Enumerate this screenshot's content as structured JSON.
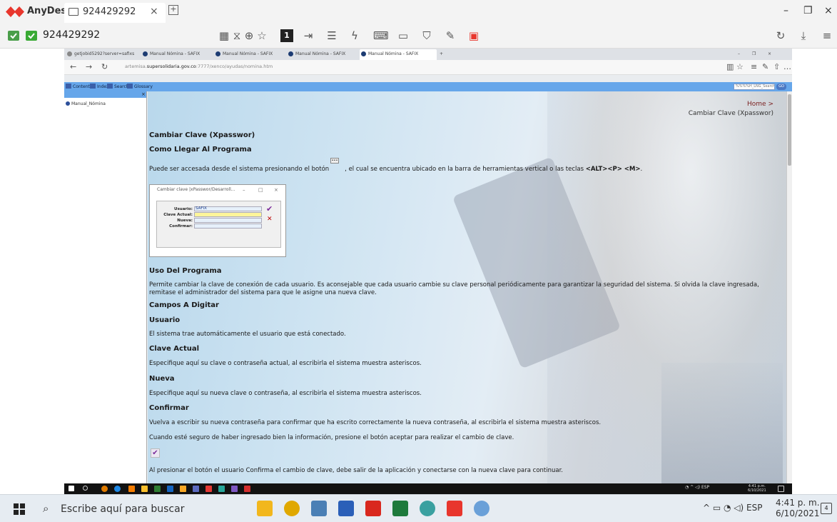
{
  "anydesk": {
    "app_name": "AnyDesk",
    "tab_label": "924429292",
    "tab_close": "×",
    "address": "924429292",
    "colors": {
      "brand_red": "#e8362d",
      "titlebar": "#f3f3f3"
    },
    "toolbar_icons": [
      "privacy-icon",
      "lock-icon",
      "star-icon",
      "monitor-1-icon",
      "switch-side-icon",
      "chat-icon",
      "actions-icon",
      "keyboard-icon",
      "display-icon",
      "shield-icon",
      "draw-icon",
      "screenshot-icon"
    ],
    "monitor_number": "1",
    "window_controls": {
      "minimize": "–",
      "restore": "❐",
      "close": "×"
    }
  },
  "edge": {
    "tabs": [
      {
        "label": "getjobid5292?server=safixs"
      },
      {
        "label": "Manual Nómina - SAFIX"
      },
      {
        "label": "Manual Nómina - SAFIX"
      },
      {
        "label": "Manual Nómina - SAFIX"
      },
      {
        "label": "Manual Nómina - SAFIX"
      }
    ],
    "url_prefix": "artemisa.",
    "url_domain": "supersolidaria.gov.co",
    "url_suffix": ":7777/xenco/ayudas/nomina.htm"
  },
  "help_toolbar": {
    "contents": "Contents",
    "index": "Index",
    "search": "Search",
    "glossary": "Glossary",
    "search_placeholder": "%%%%H_LNG_Search%%",
    "go": "GO"
  },
  "toc": {
    "root": "Manual_Nómina",
    "close": "×"
  },
  "breadcrumb": {
    "home": "Home >",
    "current": "Cambiar Clave (Xpasswor)"
  },
  "doc": {
    "title": "Cambiar Clave (Xpasswor)",
    "h_llegar": "Como Llegar Al Programa",
    "p_llegar_a": "Puede ser accesada desde el sistema presionando el botón",
    "p_llegar_b": ", el cual se encuentra ubicado en la barra de herramientas vertical o las teclas",
    "p_llegar_keys": "<ALT><P> <M>",
    "p_llegar_end": ".",
    "dialog": {
      "title": "Cambiar clave |xPasswor/Desarroll...",
      "usuario_label": "Usuario:",
      "usuario_value": "SAFIX",
      "actual_label": "Clave Actual:",
      "nueva_label": "Nueva:",
      "confirmar_label": "Confirmar:"
    },
    "h_uso": "Uso Del Programa",
    "p_uso_1": "Permite cambiar la clave de conexión de cada usuario. Es aconsejable que cada usuario cambie su clave personal periódicamente para garantizar la seguridad del sistema. Si olvida la clave ingresada,",
    "p_uso_2": "remitase el administrador del sistema para que le asigne una nueva clave.",
    "h_campos": "Campos A Digitar",
    "h_usuario": "Usuario",
    "p_usuario": "El sistema trae automáticamente el usuario que está conectado.",
    "h_actual": "Clave Actual",
    "p_actual": "Especifique aquí su clave o contraseña actual, al escribirla el sistema muestra asteriscos.",
    "h_nueva": "Nueva",
    "p_nueva": "Especifique aquí su nueva clave o contraseña, al escribirla el sistema muestra asteriscos.",
    "h_confirmar": "Confirmar",
    "p_confirmar": "Vuelva a escribir su nueva contraseña para confirmar que ha escrito correctamente la nueva contraseña, al escribirla el sistema muestra asteriscos.",
    "p_seguro": "Cuando esté seguro de haber ingresado bien la información, presione el botón aceptar para realizar el cambio de clave.",
    "p_final": "Al presionar el botón el usuario Confirma el cambio de clave, debe salir de la aplicación y conectarse con la nueva clave para continuar."
  },
  "remote_taskbar": {
    "lang": "ESP",
    "time": "4:41 p.m.",
    "date": "6/10/2021"
  },
  "taskbar": {
    "search_placeholder": "Escribe aquí para buscar",
    "lang": "ESP",
    "time": "4:41 p. m.",
    "date": "6/10/2021",
    "notifications": "4"
  }
}
